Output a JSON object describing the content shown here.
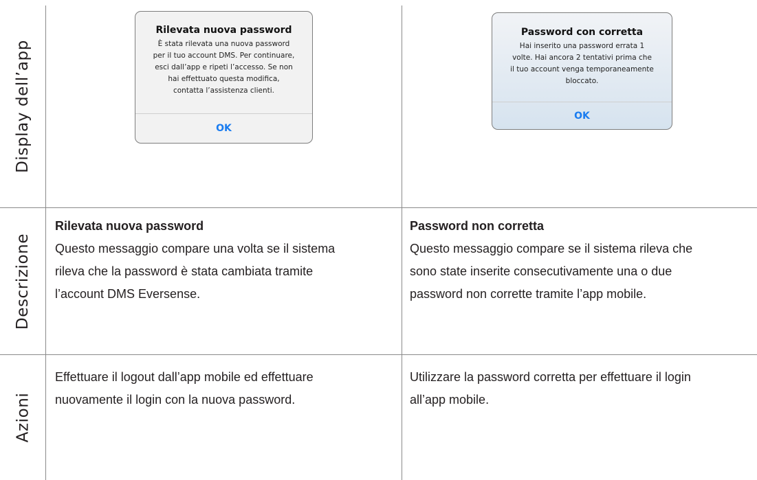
{
  "rows": {
    "display": "Display dell’app",
    "description": "Descrizione",
    "actions": "Azioni"
  },
  "dialogs": {
    "left": {
      "title": "Rilevata nuova password",
      "body_lines": [
        "È stata rilevata una nuova password",
        "per il tuo account DMS. Per continuare,",
        "esci dall’app e ripeti l’accesso. Se non",
        "hai effettuato questa modifica,",
        "contatta l’assistenza clienti."
      ],
      "button": "OK"
    },
    "right": {
      "title": "Password con corretta",
      "body_lines": [
        "Hai inserito una password errata 1",
        "volte. Hai ancora 2 tentativi prima che",
        "il tuo account venga temporaneamente",
        "bloccato."
      ],
      "button": "OK"
    }
  },
  "description": {
    "left": {
      "heading": "Rilevata nuova password",
      "lines": [
        "Questo messaggio compare una volta se il sistema",
        "rileva che la password è stata cambiata tramite",
        "l’account DMS Eversense."
      ]
    },
    "right": {
      "heading": "Password non corretta",
      "lines": [
        "Questo messaggio compare se il sistema rileva che",
        "sono state inserite consecutivamente una o due",
        "password non corrette tramite l’app mobile."
      ]
    }
  },
  "actions": {
    "left": {
      "lines": [
        "Effettuare il logout dall’app mobile ed effettuare",
        "nuovamente il login con la nuova password."
      ]
    },
    "right": {
      "lines": [
        "Utilizzare la password corretta per effettuare il login",
        "all’app mobile."
      ]
    }
  },
  "colors": {
    "grid": "#8a8a8a",
    "ok_blue": "#1a7cf0",
    "dialog_left_bg": "#f2f2f2",
    "dialog_right_bg": "#dfe8f1"
  }
}
